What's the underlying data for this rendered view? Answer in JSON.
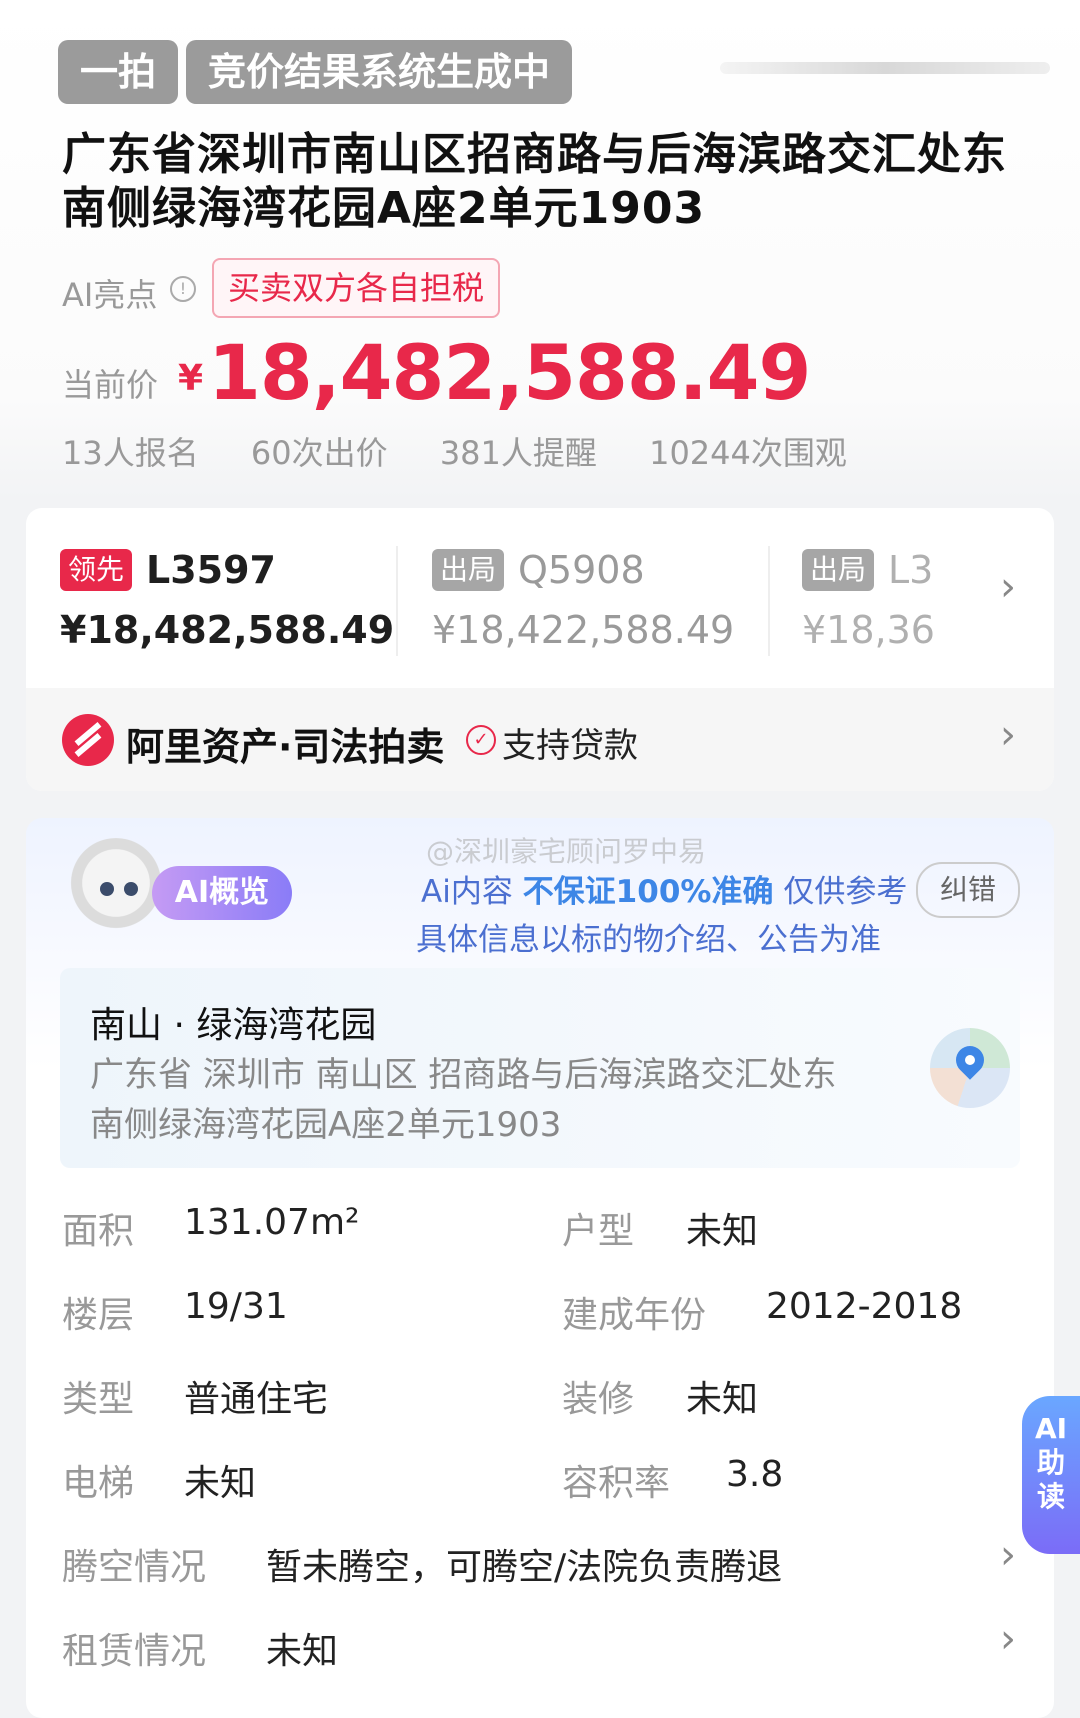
{
  "header": {
    "tag_round": "一拍",
    "tag_status": "竞价结果系统生成中",
    "title": "广东省深圳市南山区招商路与后海滨路交汇处东南侧绿海湾花园A座2单元1903",
    "ai_highlight_label": "AI亮点",
    "ai_highlight_chip": "买卖双方各自担税",
    "price_label": "当前价",
    "price_symbol": "¥",
    "price_value": "18,482,588.49",
    "stats": [
      "13人报名",
      "60次出价",
      "381人提醒",
      "10244次围观"
    ]
  },
  "bidders": [
    {
      "status": "领先",
      "code": "L3597",
      "price": "¥18,482,588.49"
    },
    {
      "status": "出局",
      "code": "Q5908",
      "price": "¥18,422,588.49"
    },
    {
      "status": "出局",
      "code": "L3",
      "price": "¥18,36"
    }
  ],
  "platform": {
    "name": "阿里资产·司法拍卖",
    "loan_label": "支持贷款"
  },
  "ai_overview": {
    "chip": "AI概览",
    "watermark": "@深圳豪宅顾问罗中易",
    "disclaimer_prefix": "Ai内容 ",
    "disclaimer_strong": "不保证100%准确",
    "disclaimer_suffix": " 仅供参考",
    "disclaimer_line2": "具体信息以标的物介绍、公告为准",
    "correct_button": "纠错",
    "community_name": "南山 · 绿海湾花园",
    "full_address": "广东省 深圳市 南山区 招商路与后海滨路交汇处东南侧绿海湾花园A座2单元1903"
  },
  "properties": {
    "area_label": "面积",
    "area_value": "131.07m²",
    "layout_label": "户型",
    "layout_value": "未知",
    "floor_label": "楼层",
    "floor_value": "19/31",
    "built_label": "建成年份",
    "built_value": "2012-2018",
    "type_label": "类型",
    "type_value": "普通住宅",
    "decor_label": "装修",
    "decor_value": "未知",
    "elevator_label": "电梯",
    "elevator_value": "未知",
    "far_label": "容积率",
    "far_value": "3.8",
    "vacate_label": "腾空情况",
    "vacate_value": "暂未腾空，可腾空/法院负责腾退",
    "lease_label": "租赁情况",
    "lease_value": "未知"
  },
  "ai_reader": [
    "AI",
    "助",
    "读"
  ]
}
